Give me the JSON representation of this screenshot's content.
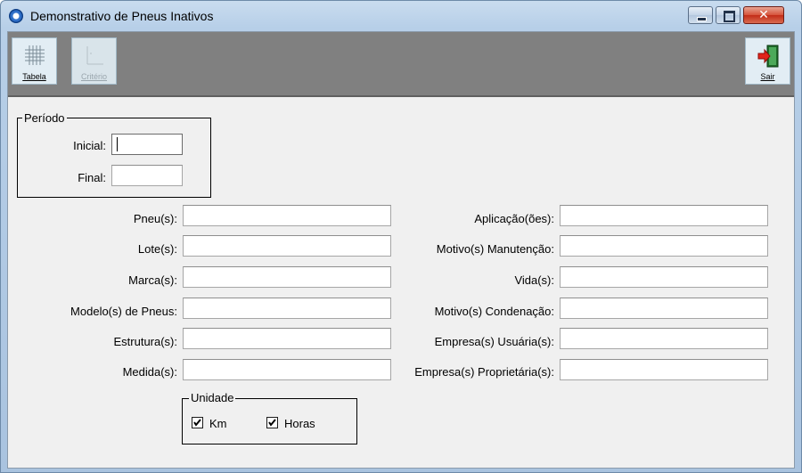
{
  "window": {
    "title": "Demonstrativo de Pneus Inativos"
  },
  "toolbar": {
    "tabela": {
      "label": "Tabela",
      "icon": "grid-icon"
    },
    "criterio": {
      "label": "Critério",
      "icon": "criteria-icon",
      "enabled": false
    },
    "sair": {
      "label": "Sair",
      "icon": "exit-door-icon"
    }
  },
  "periodo": {
    "legend": "Período",
    "inicial": {
      "label": "Inicial:",
      "value": ""
    },
    "final": {
      "label": "Final:",
      "value": ""
    }
  },
  "filters_left": [
    {
      "label": "Pneu(s):",
      "value": ""
    },
    {
      "label": "Lote(s):",
      "value": ""
    },
    {
      "label": "Marca(s):",
      "value": ""
    },
    {
      "label": "Modelo(s) de Pneus:",
      "value": ""
    },
    {
      "label": "Estrutura(s):",
      "value": ""
    },
    {
      "label": "Medida(s):",
      "value": ""
    }
  ],
  "filters_right": [
    {
      "label": "Aplicação(ões):",
      "value": ""
    },
    {
      "label": "Motivo(s) Manutenção:",
      "value": ""
    },
    {
      "label": "Vida(s):",
      "value": ""
    },
    {
      "label": "Motivo(s) Condenação:",
      "value": ""
    },
    {
      "label": "Empresa(s) Usuária(s):",
      "value": ""
    },
    {
      "label": "Empresa(s) Proprietária(s):",
      "value": ""
    }
  ],
  "unidade": {
    "legend": "Unidade",
    "km": {
      "label": "Km",
      "checked": true
    },
    "horas": {
      "label": "Horas",
      "checked": true
    }
  }
}
